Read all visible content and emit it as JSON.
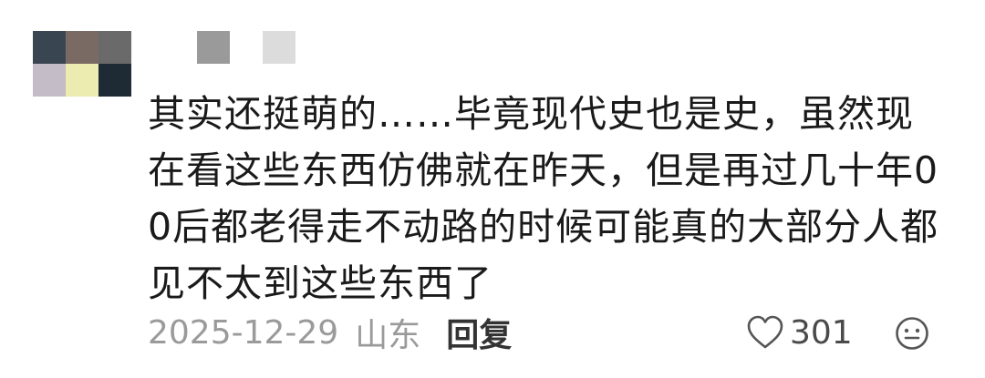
{
  "avatar": {
    "pixels": [
      "#3a4552",
      "#7a6a64",
      "#6a6a6a",
      "#c4bcc6",
      "#ecebb0",
      "#1e2a34"
    ]
  },
  "username": {
    "blocks": [
      "#9a9a9a",
      "#dcdcdc"
    ]
  },
  "comment": {
    "text": "其实还挺萌的……毕竟现代史也是史，虽然现在看这些东西仿佛就在昨天，但是再过几十年00后都老得走不动路的时候可能真的大部分人都见不太到这些东西了"
  },
  "meta": {
    "date": "2025-12-29",
    "location": "山东",
    "reply_label": "回复"
  },
  "like": {
    "count": "301",
    "icon": "heart-outline-icon"
  },
  "emoji_button": {
    "icon": "smiley-face-icon"
  }
}
